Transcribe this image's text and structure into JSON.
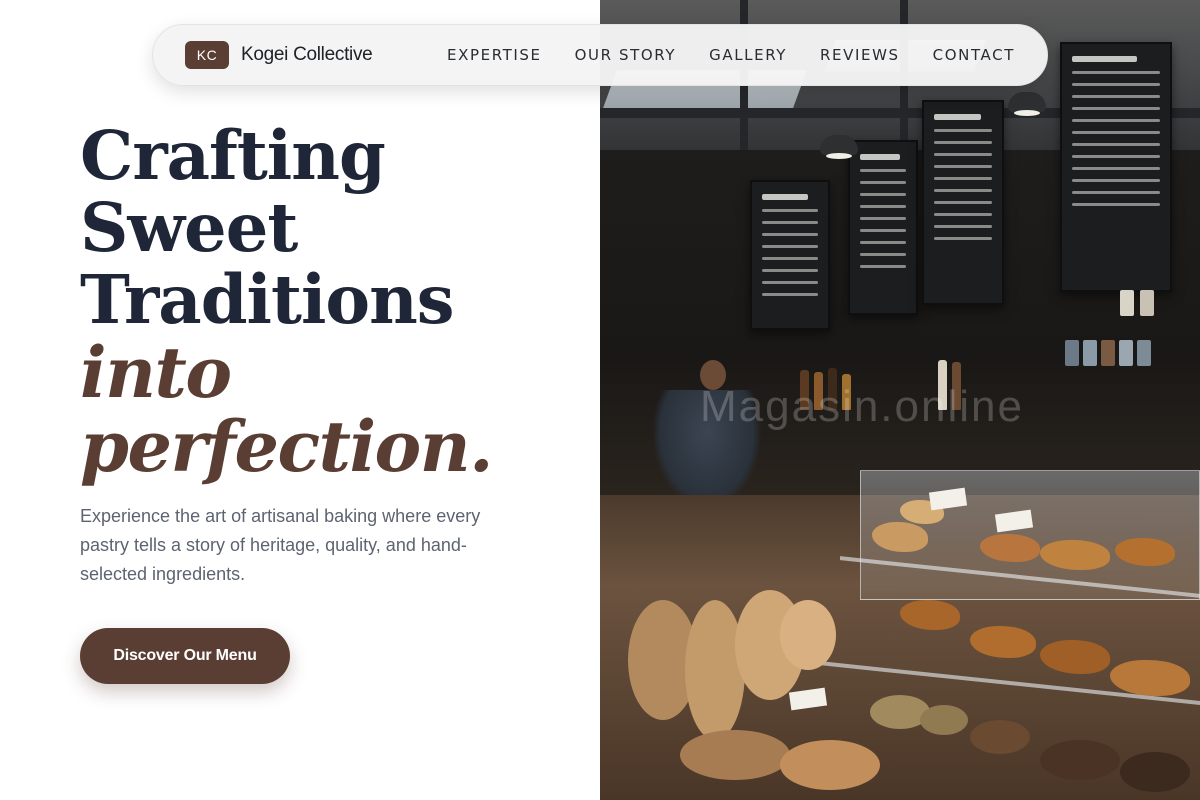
{
  "nav": {
    "logo_initials": "KC",
    "brand_name": "Kogei Collective",
    "links": [
      "EXPERTISE",
      "OUR STORY",
      "GALLERY",
      "REVIEWS",
      "CONTACT"
    ]
  },
  "hero": {
    "title_lines": [
      "Crafting",
      "Sweet",
      "Traditions"
    ],
    "title_accent_lines": [
      "into",
      "perfection."
    ],
    "description": "Experience the art of artisanal baking where every pastry tells a story of heritage, quality, and hand-selected ingredients.",
    "cta_label": "Discover Our Menu"
  },
  "watermark": "Magasin.online",
  "colors": {
    "accent": "#5b3e33",
    "heading": "#1e2638",
    "body_text": "#5d6370",
    "nav_background": "#f4f4f4"
  },
  "photo": {
    "subject": "bakery-interior-photo"
  }
}
